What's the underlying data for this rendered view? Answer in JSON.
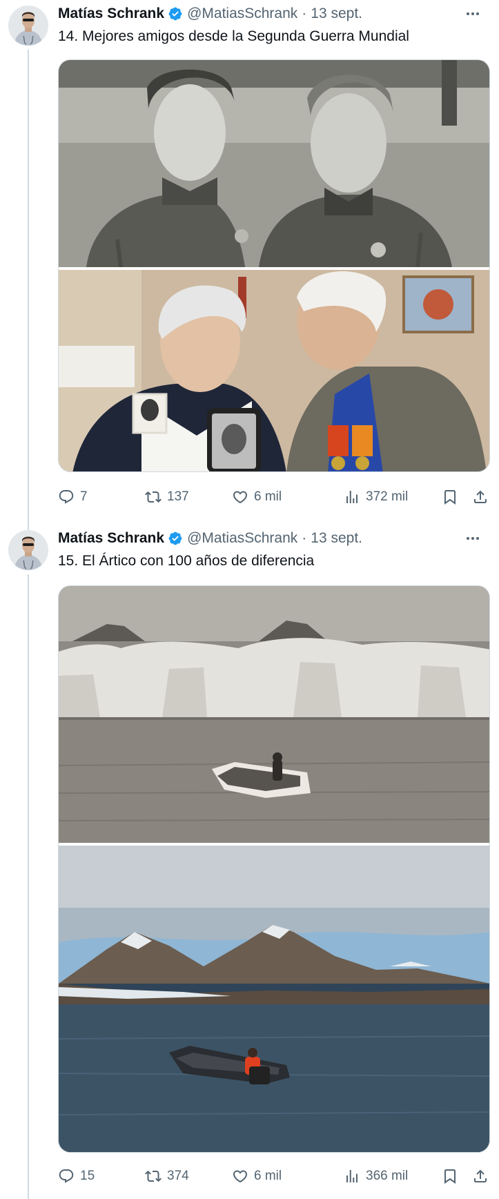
{
  "tweets": [
    {
      "author_name": "Matías Schrank",
      "handle": "@MatiasSchrank",
      "separator": "·",
      "date": "13 sept.",
      "text": "14. Mejores amigos desde la Segunda Guerra Mundial",
      "replies": "7",
      "retweets": "137",
      "likes": "6 mil",
      "views": "372 mil"
    },
    {
      "author_name": "Matías Schrank",
      "handle": "@MatiasSchrank",
      "separator": "·",
      "date": "13 sept.",
      "text": "15. El Ártico con 100 años de diferencia",
      "replies": "15",
      "retweets": "374",
      "likes": "6 mil",
      "views": "366 mil"
    }
  ],
  "colors": {
    "text_primary": "#0f1419",
    "text_secondary": "#536471",
    "verified_blue": "#1d9bf0",
    "thread_line": "#cfd9de"
  },
  "icons": [
    "verified-badge-icon",
    "more-icon",
    "reply-icon",
    "retweet-icon",
    "like-icon",
    "views-icon",
    "bookmark-icon",
    "share-icon"
  ]
}
